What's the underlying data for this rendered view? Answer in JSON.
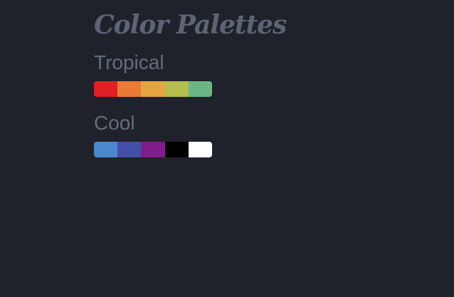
{
  "page": {
    "title": "Color Palettes"
  },
  "palettes": [
    {
      "name": "Tropical",
      "colors": [
        "#df2127",
        "#ea7a35",
        "#e6a540",
        "#b6be4e",
        "#6ab581"
      ]
    },
    {
      "name": "Cool",
      "colors": [
        "#4a88cb",
        "#4350a9",
        "#7f1e8b",
        "#000000",
        "#ffffff"
      ]
    }
  ],
  "theme": {
    "background": "#1f222a",
    "text": "#656c7b"
  }
}
